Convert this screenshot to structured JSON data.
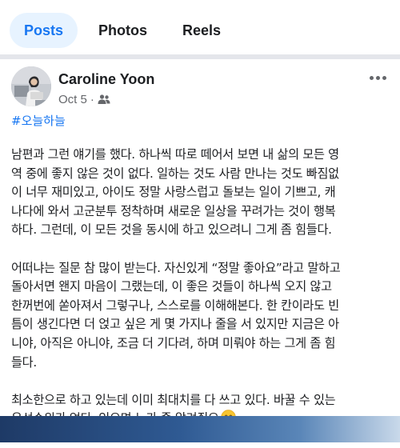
{
  "tabs": [
    {
      "label": "Posts"
    },
    {
      "label": "Photos"
    },
    {
      "label": "Reels"
    }
  ],
  "post": {
    "author": "Caroline Yoon",
    "date": "Oct 5",
    "separator": "·",
    "audience_icon": "friends-icon",
    "hashtag": "#오늘하늘",
    "paragraphs": [
      "남편과 그런 얘기를 했다. 하나씩 따로 떼어서 보면 내 삶의 모든 영\n역 중에 좋지 않은 것이 없다. 일하는 것도 사람 만나는 것도 빠짐없\n이 너무 재미있고, 아이도 정말 사랑스럽고 돌보는 일이 기쁘고, 캐\n나다에 와서 고군분투 정착하며 새로운 일상을 꾸려가는 것이 행복\n하다. 그런데, 이 모든 것을 동시에 하고 있으려니 그게 좀 힘들다.",
      "어떠냐는 질문 참 많이 받는다. 자신있게 “정말 좋아요”라고 말하고\n돌아서면 왠지 마음이 그랬는데, 이 좋은 것들이 하나씩 오지 않고\n한꺼번에 쏟아져서 그렇구나, 스스로를 이해해본다. 한 칸이라도 빈\n틈이 생긴다면 더 얹고 싶은 게 몇 가지나 줄을 서 있지만 지금은 아\n니야, 아직은 아니야, 조금 더 기다려, 하며 미뤄야 하는 그게 좀 힘\n들다.",
      "최소한으로 하고 있는데 이미 최대치를 다 쓰고 있다. 바꿀 수 있는\n우선순위가 없다. 있으면 누가 좀 알려줘요"
    ],
    "end_emoji": "tearful-smile-emoji"
  },
  "colors": {
    "accent": "#1877f2",
    "active_tab_bg": "#e7f3ff",
    "text": "#1c1e21",
    "secondary_text": "#65676b"
  }
}
